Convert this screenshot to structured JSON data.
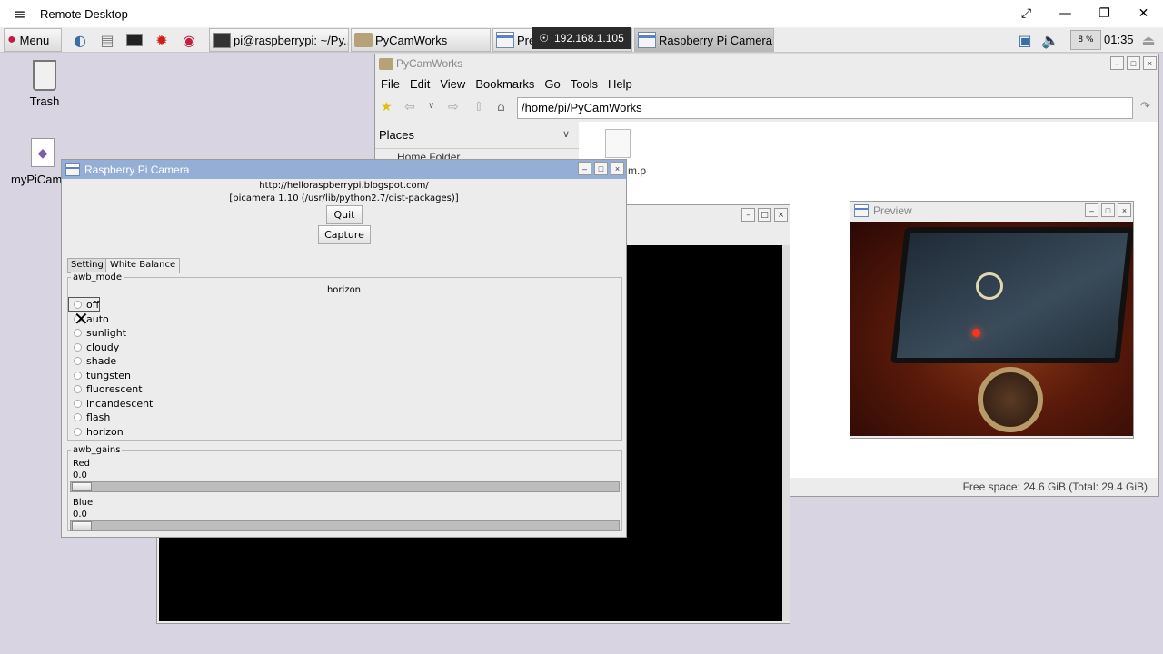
{
  "remote_desktop": {
    "title": "Remote Desktop",
    "menu_glyph": "≡",
    "restore_glyph": "⤢",
    "minimize_glyph": "—",
    "maximize_glyph": "❐",
    "close_glyph": "✕"
  },
  "taskbar": {
    "menu_label": "Menu",
    "tasks": [
      "pi@raspberrypi: ~/Py...",
      "PyCamWorks",
      "Pre",
      "Raspberry Pi Camera"
    ],
    "connection": "192.168.1.105",
    "cpu": "8 %",
    "clock": "01:35"
  },
  "desktop": {
    "icons": [
      "Trash",
      "myPiCam"
    ]
  },
  "file_manager": {
    "title": "PyCamWorks",
    "menus": [
      "File",
      "Edit",
      "View",
      "Bookmarks",
      "Go",
      "Tools",
      "Help"
    ],
    "path": "/home/pi/PyCamWorks",
    "places_label": "Places",
    "places_items": [
      "Home Folder"
    ],
    "file_name": "m.p",
    "status": "Free space: 24.6 GiB (Total: 29.4 GiB)"
  },
  "preview": {
    "title": "Preview"
  },
  "camera": {
    "title": "Raspberry Pi Camera",
    "url": "http://helloraspberrypi.blogspot.com/",
    "version": "[picamera 1.10 (/usr/lib/python2.7/dist-packages)]",
    "quit": "Quit",
    "capture": "Capture",
    "tabs": [
      "Setting",
      "White Balance"
    ],
    "awb_mode_label": "awb_mode",
    "awb_mode_value": "horizon",
    "modes": [
      "off",
      "auto",
      "sunlight",
      "cloudy",
      "shade",
      "tungsten",
      "fluorescent",
      "incandescent",
      "flash",
      "horizon"
    ],
    "awb_gains_label": "awb_gains",
    "red_label": "Red",
    "red_value": "0.0",
    "blue_label": "Blue",
    "blue_value": "0.0"
  }
}
